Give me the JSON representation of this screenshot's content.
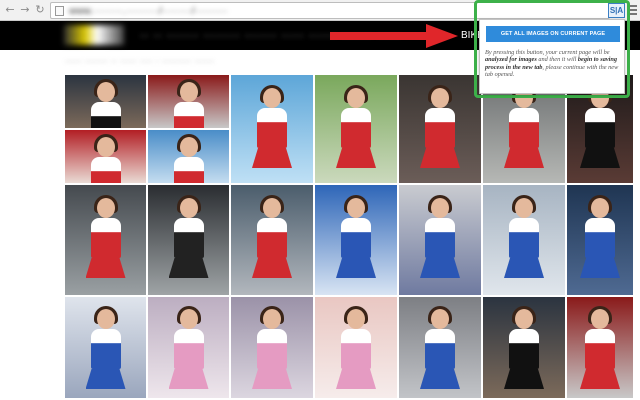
{
  "browser": {
    "back_icon": "back-arrow-icon",
    "forward_icon": "forward-arrow-icon",
    "reload_icon": "reload-icon",
    "address": "www.·········.··········/·········/··········",
    "star_icon": "star-icon",
    "extension_label": "S|A",
    "menu_icon": "hamburger-menu-icon"
  },
  "site": {
    "logo": "··········",
    "nav": "·· ··  ·······  ········  ·······  ·····  ······  ·······  ·····",
    "nav_visible": "BIKE",
    "sub_header": "····· ······· ·· ····· ···· · ········· ······"
  },
  "annotation": {
    "arrow_color": "#e0262a",
    "highlight_color": "#3db14a"
  },
  "extension_popup": {
    "button_label": "GET ALL IMAGES ON CURRENT PAGE",
    "desc_1": "By pressing this button, your current page will be ",
    "desc_2": "analyzed for images",
    "desc_3": " and then it will ",
    "desc_4": "begin to saving process in the new tab",
    "desc_5": ", please continue with the new tab opened."
  },
  "gallery": {
    "columns": 7,
    "photos": [
      {
        "name": "photo-grid-girls-group",
        "theme": "night"
      },
      {
        "name": "photo-grid-girl-red-dress-mirror",
        "theme": "red"
      },
      {
        "name": "photo-grid-girl-portrait-red-white",
        "theme": "sky"
      },
      {
        "name": "photo-grid-girl-standing-red-white",
        "theme": "green"
      },
      {
        "name": "photo-grid-girl-pitlane-night",
        "theme": "dark"
      },
      {
        "name": "photo-grid-girl-grid-red",
        "theme": "track"
      },
      {
        "name": "photo-grid-couple-celebrity",
        "theme": "night2"
      },
      {
        "name": "photo-grid-girl-pit-crew",
        "theme": "red2"
      },
      {
        "name": "photo-grid-girl-blue-sky-red",
        "theme": "sky2"
      },
      {
        "name": "photo-grid-girl-track-shadow",
        "theme": "track2"
      },
      {
        "name": "photo-grid-girl-silhouette",
        "theme": "silhouette"
      },
      {
        "name": "photo-grid-grandstand",
        "theme": "stand"
      },
      {
        "name": "photo-grid-grid-girl-number",
        "theme": "blue"
      },
      {
        "name": "photo-grid-girl-portrait-blue",
        "theme": "blueportrait"
      },
      {
        "name": "photo-grid-girl-blue-standing",
        "theme": "bluesky"
      },
      {
        "name": "photo-grid-girl-blue-portrait-2",
        "theme": "blueportrait2"
      },
      {
        "name": "photo-grid-girl-blue-portrait-3",
        "theme": "blueportrait3"
      },
      {
        "name": "photo-grid-kimono-girls",
        "theme": "kimono"
      },
      {
        "name": "photo-grid-kimono-girls-2",
        "theme": "kimono2"
      },
      {
        "name": "photo-grid-kimono-portrait",
        "theme": "kimono3"
      },
      {
        "name": "photo-grid-girl-with-flag",
        "theme": "flag"
      }
    ]
  }
}
